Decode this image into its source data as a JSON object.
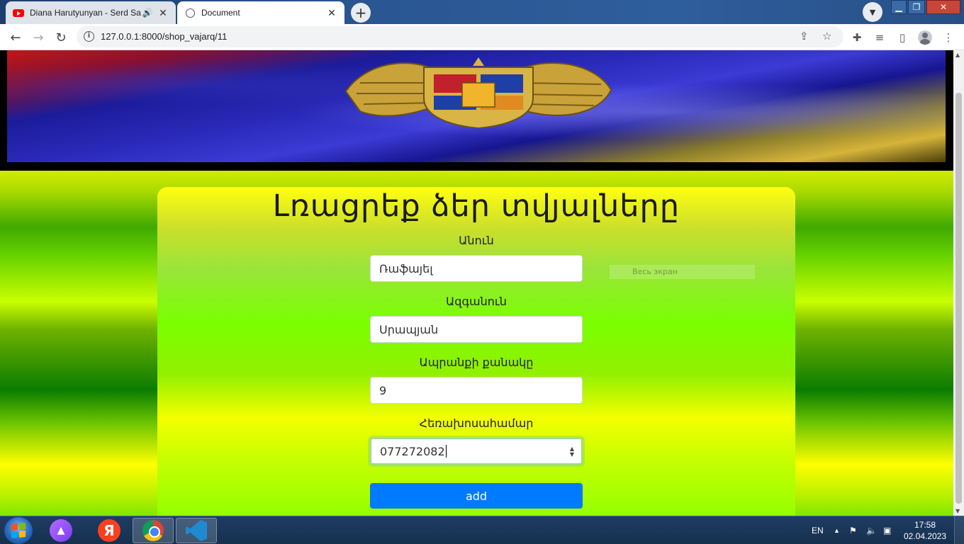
{
  "browser": {
    "tabs": [
      {
        "title": "Diana Harutyunyan - Serd Sa",
        "icon": "youtube-icon",
        "audio": true
      },
      {
        "title": "Document",
        "icon": "globe-icon",
        "active": true
      }
    ],
    "url": "127.0.0.1:8000/shop_vajarq/11"
  },
  "form": {
    "heading": "Լռացրեք ձեր տվյալները",
    "fields": [
      {
        "label": "Անուն",
        "value": "Ռաֆայել"
      },
      {
        "label": "Ազգանուն",
        "value": "Սրապյան"
      },
      {
        "label": "Ապրանքի քանակը",
        "value": "9"
      },
      {
        "label": "Հեռախոսահամար",
        "value": "077272082"
      }
    ],
    "submit_label": "add",
    "ghost_overlay": "Весь экран"
  },
  "colors": {
    "button": "#007bff",
    "focus_ring": "#9bd89b"
  },
  "taskbar": {
    "apps": [
      "windows-start",
      "alice",
      "yandex",
      "chrome",
      "vscode"
    ],
    "language": "EN",
    "time": "17:58",
    "date": "02.04.2023"
  }
}
